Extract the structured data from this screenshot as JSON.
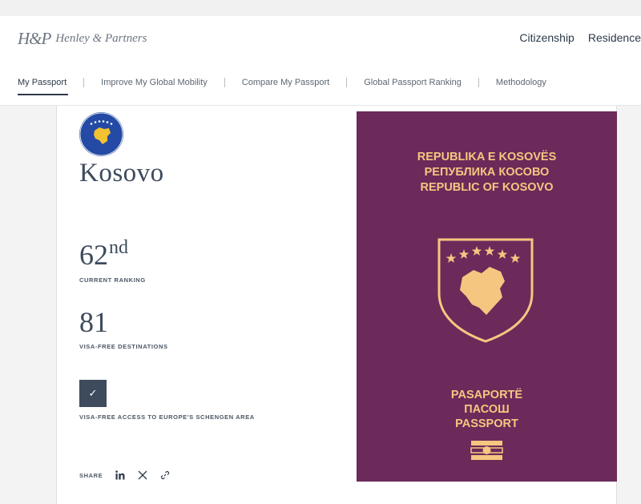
{
  "header": {
    "logo_mark": "H&P",
    "logo_text": "Henley & Partners",
    "nav": [
      "Citizenship",
      "Residence"
    ]
  },
  "subnav": {
    "items": [
      "My Passport",
      "Improve My Global Mobility",
      "Compare My Passport",
      "Global Passport Ranking",
      "Methodology"
    ],
    "active": "My Passport"
  },
  "country": {
    "name": "Kosovo",
    "flag_colors": {
      "field": "#244aa5",
      "map": "#f2c230",
      "stars": "#ffffff"
    }
  },
  "stats": {
    "ranking": "62",
    "ranking_suffix": "nd",
    "ranking_label": "CURRENT RANKING",
    "visa_free": "81",
    "visa_free_label": "VISA-FREE DESTINATIONS",
    "schengen_checked": true,
    "schengen_label": "VISA-FREE ACCESS TO EUROPE'S SCHENGEN AREA"
  },
  "share": {
    "label": "SHARE",
    "icons": [
      "linkedin-icon",
      "x-icon",
      "link-icon"
    ]
  },
  "passport": {
    "cover_color": "#6b2a5a",
    "ink_color": "#f5c680",
    "title_lines": [
      "REPUBLIKA E KOSOVËS",
      "РЕПУБЛИКА КОСОВО",
      "REPUBLIC OF KOSOVO"
    ],
    "bottom_lines": [
      "PASAPORTË",
      "ПАСОШ",
      "PASSPORT"
    ]
  }
}
